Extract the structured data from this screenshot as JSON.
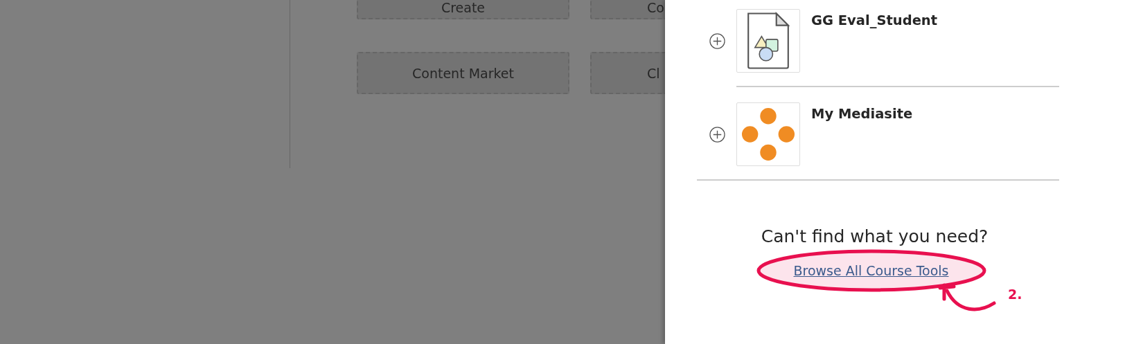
{
  "background_buttons": [
    {
      "label": "Create",
      "cut_label": "Co"
    },
    {
      "label": "Content Market",
      "cut_label": "Cl"
    }
  ],
  "panel": {
    "tools": [
      {
        "name": "GG Eval_Student",
        "kind": "file"
      },
      {
        "name": "My Mediasite",
        "kind": "dots"
      }
    ],
    "help_text": "Can't find what you need?",
    "link": "Browse All Course Tools"
  },
  "annotation": {
    "label": "2."
  }
}
